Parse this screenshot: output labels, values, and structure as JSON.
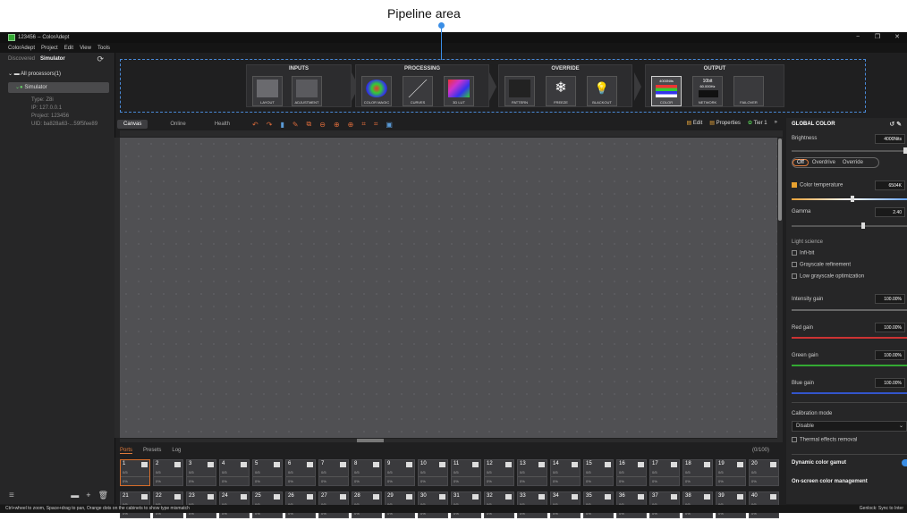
{
  "annotation": {
    "title": "Pipeline area"
  },
  "window": {
    "title": "123456 -- ColorAdept",
    "min": "−",
    "max": "❐",
    "close": "✕"
  },
  "menu": [
    "ColorAdept",
    "Project",
    "Edit",
    "View",
    "Tools"
  ],
  "left": {
    "tabs": [
      "Discovered",
      "Simulator"
    ],
    "tree_root": "All processors(1)",
    "processor": "Simulator",
    "info": [
      "Type: Z8i",
      "IP: 127.0.0.1",
      "Project: 123456",
      "UID: ba828a63-...59f5fee89"
    ]
  },
  "pipeline": {
    "stages": [
      {
        "name": "INPUTS",
        "cards": [
          "LAYOUT",
          "ADJUSTMENT"
        ]
      },
      {
        "name": "PROCESSING",
        "cards": [
          "COLOR MAGIC",
          "CURVES",
          "3D LUT"
        ]
      },
      {
        "name": "OVERRIDE",
        "cards": [
          "PATTERN",
          "FREEZE",
          "BLACKOUT"
        ]
      },
      {
        "name": "OUTPUT",
        "cards": [
          "COLOR",
          "NETWORK",
          "FAILOVER"
        ]
      }
    ],
    "color_card": "4000Nits",
    "network_card": [
      "10bit",
      "60.000Hz"
    ]
  },
  "toolbar": {
    "tabs": [
      "Canvas",
      "Online",
      "Health"
    ],
    "edit": "Edit",
    "properties": "Properties",
    "tier": "Tier 1",
    "more": "»"
  },
  "bottom": {
    "tabs": [
      "Ports",
      "Presets",
      "Log"
    ],
    "count": "(0/100)",
    "port_value": "0/5",
    "port_pct": "0%"
  },
  "right": {
    "title": "GLOBAL COLOR",
    "brightness_label": "Brightness",
    "brightness": "4000Nits",
    "modes": [
      "Off",
      "Overdrive",
      "Override"
    ],
    "color_temp_label": "Color temperature",
    "color_temp": "6504K",
    "gamma_label": "Gamma",
    "gamma": "2.40",
    "light_science": "Light science",
    "checks": [
      "Infi-bit",
      "Grayscale refinement",
      "Low grayscale optimization"
    ],
    "intensity_label": "Intensity gain",
    "intensity": "100.00%",
    "red_label": "Red gain",
    "red": "100.00%",
    "green_label": "Green gain",
    "green": "100.00%",
    "blue_label": "Blue gain",
    "blue": "100.00%",
    "calib_label": "Calibration mode",
    "calib": "Disable",
    "thermal": "Thermal effects removal",
    "dynamic": "Dynamic color gamut",
    "onscreen": "On-screen color management"
  },
  "status": {
    "left": "Ctrl+wheel to zoom, Space+drag to pan, Orange dots on the cabinets to show type mismatch",
    "right": "Genlock: Sync to Inter"
  }
}
